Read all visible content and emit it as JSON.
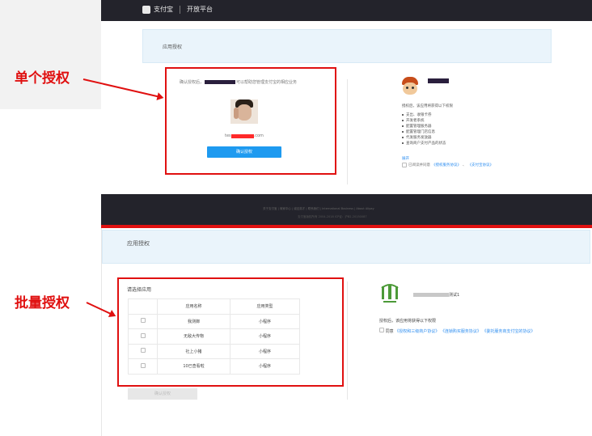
{
  "top": {
    "brand": "支付宝",
    "portal": "开放平台",
    "card_title": "应用授权",
    "desc_prefix": "确认授权后，",
    "desc_suffix": "可以帮助您管理支付宝的相应业务",
    "account_prefix": "tes",
    "account_suffix": ".com",
    "confirm_button": "确认授权",
    "perms_title": "授权后，该应用将获得以下权限",
    "permissions": [
      "支出、收银卡券",
      "开发者系统",
      "配置管理服务器",
      "配置管理门店信息",
      "代发服务发放器",
      "查询商户支付产品的状态"
    ],
    "more": "展开",
    "agree_prefix": "已阅读并同意",
    "agreement_1": "《授权服务协议》",
    "agreement_sep": "、",
    "agreement_2": "《支付宝协议》"
  },
  "footer": {
    "links": "关于支付宝 | 商家中心 | 诚征英才 | 联系我们 | International Business | About Alipay",
    "copyright": "支付宝版权所有 2004-2018 ICP证：沪B2-20150087"
  },
  "bottom": {
    "card_title": "应用授权",
    "select_label": "请选择应用",
    "col_name": "应用名称",
    "col_type": "应用类型",
    "rows": [
      {
        "name": "我测御",
        "type": "小程序"
      },
      {
        "name": "无敌大传物",
        "type": "小程序"
      },
      {
        "name": "社上小猪",
        "type": "小程序"
      },
      {
        "name": "10已查看啦",
        "type": "小程序"
      }
    ],
    "confirm_button": "确认授权",
    "app_name_suffix": "测试1",
    "perms_text": "授权后，该应用将获得以下权限",
    "agree_prefix": "同意",
    "agreement_1": "《授权和三级商户协议》",
    "agreement_2": "《连锁购买服务协议》",
    "agreement_3": "《委托服务商支付宝的协议》"
  },
  "annotations": {
    "single": "单个授权",
    "batch": "批量授权"
  }
}
